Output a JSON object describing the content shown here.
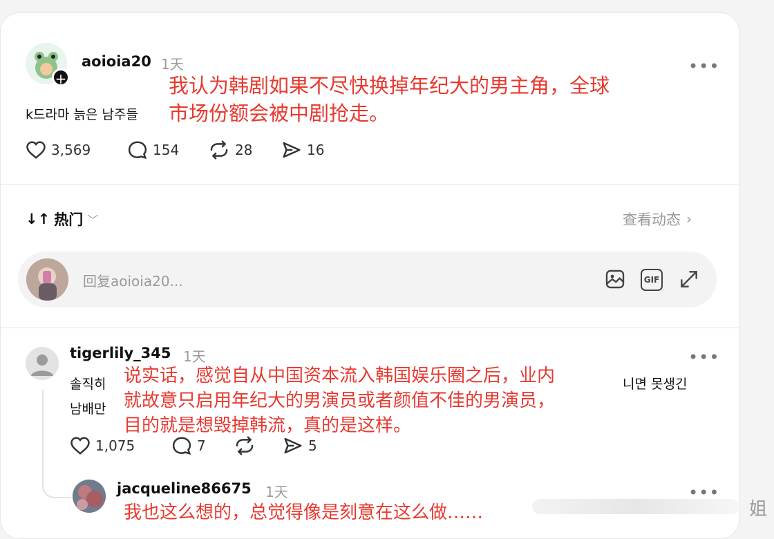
{
  "post": {
    "username": "aoioia20",
    "time": "1天",
    "korean_text": "k드라마 늙은 남주들",
    "overlay_text_line1": "我认为韩剧如果不尽快换掉年纪大的男主角，全球",
    "overlay_text_line2": "市场份额会被中剧抢走。",
    "likes": "3,569",
    "comments": "154",
    "reposts": "28",
    "shares": "16"
  },
  "sort": {
    "label": "热门",
    "view_activity": "查看动态"
  },
  "reply_box": {
    "placeholder": "回复aoioia20..."
  },
  "comments": [
    {
      "username": "tigerlily_345",
      "time": "1天",
      "korean_line1_start": "솔직히",
      "korean_line1_end": "니면 못생긴",
      "korean_line2_start": "남배만",
      "overlay_line1": "说实话，感觉自从中国资本流入韩国娱乐圈之后，业内",
      "overlay_line2": "就故意只启用年纪大的男演员或者颜值不佳的男演员，",
      "overlay_line3": "目的就是想毁掉韩流，真的是这样。",
      "likes": "1,075",
      "comments": "7",
      "shares": "5"
    },
    {
      "username": "jacqueline86675",
      "time": "1天",
      "overlay_line1": "我也这么想的，总觉得像是刻意在这么做……"
    }
  ],
  "watermark": "姐"
}
